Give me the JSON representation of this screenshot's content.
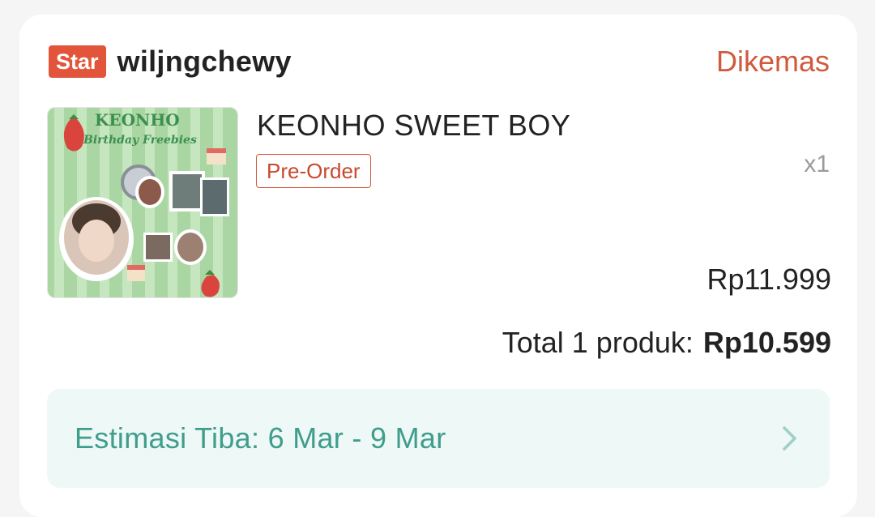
{
  "shop": {
    "badge": "Star",
    "name": "wiljngchewy",
    "status": "Dikemas"
  },
  "product": {
    "title": "KEONHO SWEET BOY",
    "tag": "Pre-Order",
    "quantity": "x1",
    "price": "Rp11.999",
    "image_text": {
      "line1": "KEONHO",
      "line2": "Birthday Freebies"
    }
  },
  "total": {
    "label": "Total 1 produk:",
    "amount": "Rp10.599"
  },
  "estimate": {
    "text": "Estimasi Tiba: 6 Mar - 9 Mar"
  },
  "colors": {
    "accent": "#d05a3c",
    "badge": "#e2553a",
    "estimate_text": "#3f9d8c",
    "estimate_bg": "#eef8f6"
  },
  "icons": {
    "estimate_arrow": "chevron-right-icon"
  }
}
